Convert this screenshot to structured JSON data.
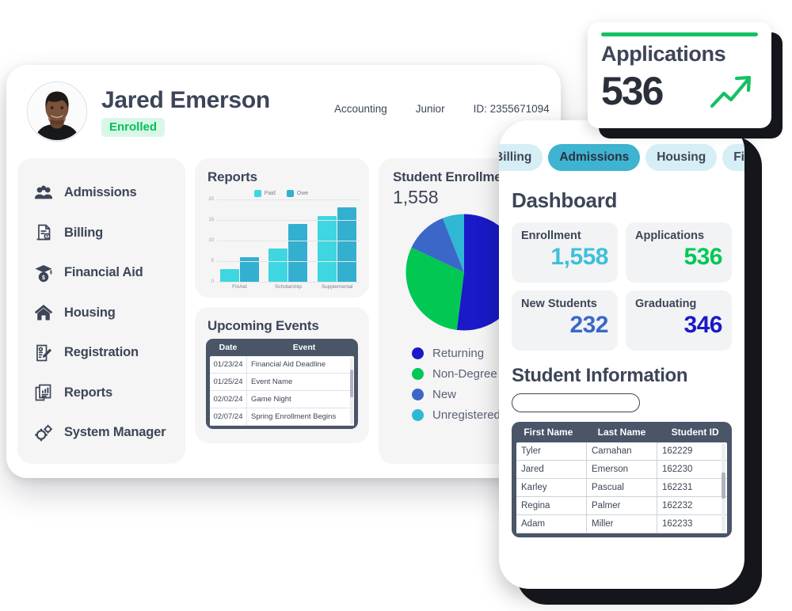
{
  "desktop": {
    "student": {
      "name": "Jared Emerson",
      "status_badge": "Enrolled",
      "major": "Accounting",
      "year": "Junior",
      "id": "ID: 2355671094"
    },
    "sidebar": {
      "items": [
        {
          "label": "Admissions",
          "icon": "users-icon"
        },
        {
          "label": "Billing",
          "icon": "invoice-icon"
        },
        {
          "label": "Financial Aid",
          "icon": "graduation-money-icon"
        },
        {
          "label": "Housing",
          "icon": "home-icon"
        },
        {
          "label": "Registration",
          "icon": "form-pencil-icon"
        },
        {
          "label": "Reports",
          "icon": "report-chart-icon"
        },
        {
          "label": "System Manager",
          "icon": "gears-icon"
        }
      ]
    },
    "reports": {
      "title": "Reports"
    },
    "events": {
      "title": "Upcoming Events",
      "columns": [
        "Date",
        "Event"
      ],
      "rows": [
        {
          "date": "01/23/24",
          "event": "Financial Aid Deadline"
        },
        {
          "date": "01/25/24",
          "event": "Event Name"
        },
        {
          "date": "02/02/24",
          "event": "Game Night"
        },
        {
          "date": "02/07/24",
          "event": "Spring Enrollment Begins"
        }
      ]
    },
    "enrollment": {
      "title": "Student Enrollment",
      "total": "1,558"
    }
  },
  "phone": {
    "tabs": [
      {
        "label": "Billing",
        "active": false
      },
      {
        "label": "Admissions",
        "active": true
      },
      {
        "label": "Housing",
        "active": false
      },
      {
        "label": "Financial",
        "active": false
      }
    ],
    "dashboard_title": "Dashboard",
    "stats": [
      {
        "label": "Enrollment",
        "value": "1,558",
        "color": "#3fc0d8"
      },
      {
        "label": "Applications",
        "value": "536",
        "color": "#00c853"
      },
      {
        "label": "New Students",
        "value": "232",
        "color": "#3b68c8"
      },
      {
        "label": "Graduating",
        "value": "346",
        "color": "#1a1ac8"
      }
    ],
    "student_info_title": "Student Information",
    "search": {
      "placeholder": "",
      "value": "",
      "left_icon": "search-icon",
      "right_icon": "microphone-icon"
    },
    "table": {
      "columns": [
        "First Name",
        "Last Name",
        "Student ID"
      ],
      "rows": [
        {
          "first": "Tyler",
          "last": "Carnahan",
          "id": "162229"
        },
        {
          "first": "Jared",
          "last": "Emerson",
          "id": "162230"
        },
        {
          "first": "Karley",
          "last": "Pascual",
          "id": "162231"
        },
        {
          "first": "Regina",
          "last": "Palmer",
          "id": "162232"
        },
        {
          "first": "Adam",
          "last": "Miller",
          "id": "162233"
        }
      ]
    }
  },
  "float_card": {
    "title": "Applications",
    "value": "536",
    "accent": "#14c064",
    "trend_icon": "trending-up-arrow-icon"
  },
  "chart_data": [
    {
      "type": "bar",
      "title": "Reports",
      "categories": [
        "FinAid",
        "Scholarship",
        "Supplemental"
      ],
      "series": [
        {
          "name": "Paid",
          "values": [
            3,
            8,
            16
          ],
          "color": "#3ed6e0"
        },
        {
          "name": "Owe",
          "values": [
            6,
            14,
            18
          ],
          "color": "#33afd0"
        }
      ],
      "xlabel": "",
      "ylabel": "",
      "ylim": [
        0,
        20
      ],
      "yticks": [
        0,
        5,
        10,
        15,
        20
      ],
      "grid": true,
      "legend_position": "top"
    },
    {
      "type": "pie",
      "title": "Student Enrollment",
      "total": "1,558",
      "labels": [
        "Returning",
        "Non-Degree",
        "New",
        "Unregistered"
      ],
      "values": [
        52,
        30,
        12,
        6
      ],
      "colors": [
        "#1a1ac8",
        "#00c853",
        "#3b68c8",
        "#2eb8d4"
      ],
      "legend_position": "bottom"
    }
  ]
}
